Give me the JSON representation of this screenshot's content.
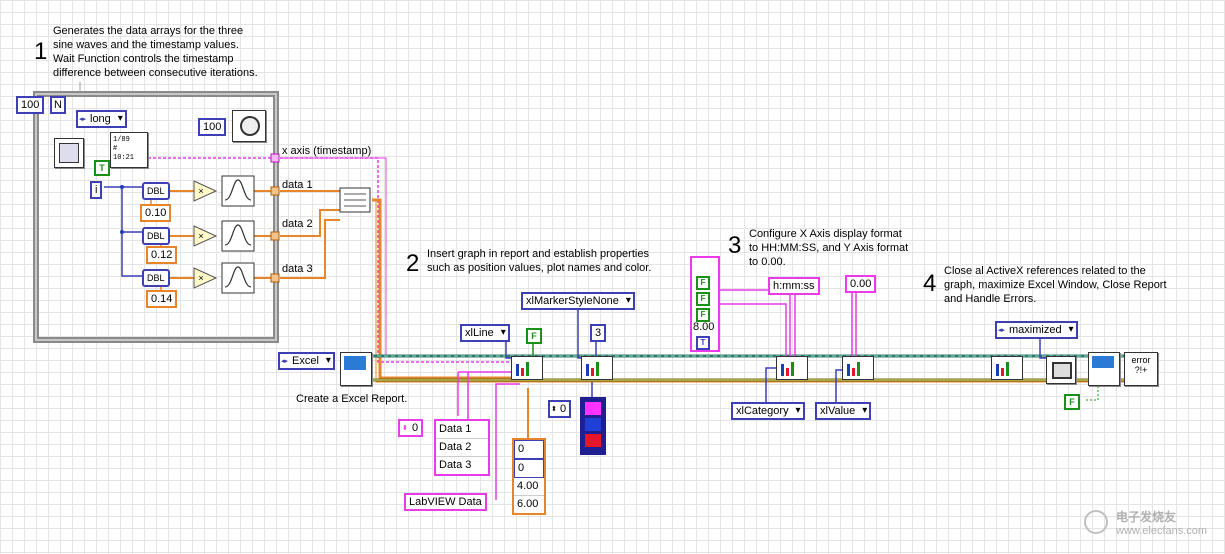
{
  "notes": {
    "step1_num": "1",
    "step1_text": "Generates the data arrays for the three\nsine waves and the timestamp values.\nWait Function controls the timestamp\ndifference between consecutive iterations.",
    "step2_num": "2",
    "step2_text": "Insert graph in report and establish properties\nsuch as position values, plot names and color.",
    "step3_num": "3",
    "step3_text": "Configure X Axis display format\nto HH:MM:SS, and Y Axis format\nto 0.00.",
    "step4_num": "4",
    "step4_text": "Close al ActiveX references related to the\ngraph, maximize Excel Window, Close Report\nand Handle Errors.",
    "create_report": "Create a Excel Report."
  },
  "loop": {
    "count": "100",
    "count_terminal": "N",
    "iteration_terminal": "i",
    "format_enum": "long",
    "wait_ms": "100",
    "true_const": "T"
  },
  "wire_labels": {
    "x_axis": "x axis (timestamp)",
    "data1": "data 1",
    "data2": "data 2",
    "data3": "data 3"
  },
  "sine_rows": [
    {
      "dbl": "DBL",
      "factor": "0.10"
    },
    {
      "dbl": "DBL",
      "factor": "0.12"
    },
    {
      "dbl": "DBL",
      "factor": "0.14"
    }
  ],
  "report": {
    "type": "Excel",
    "line_enum": "xlLine",
    "false_const": "F",
    "marker_enum": "xlMarkerStyleNone",
    "marker_num": "3",
    "plot_names_index": "0",
    "plot_names": [
      "Data 1",
      "Data 2",
      "Data 3"
    ],
    "position_values": [
      "0",
      "0",
      "4.00",
      "6.00"
    ],
    "series_name": "LabVIEW Data",
    "color_index": "0",
    "colors": [
      "#ff33ff",
      "#1f3fd6",
      "#e5162b"
    ]
  },
  "axis": {
    "bool_cluster": [
      "F",
      "F",
      "F"
    ],
    "number": "8.00",
    "true_const": "T",
    "time_format": "h:mm:ss",
    "y_format": "0.00",
    "category_enum": "xlCategory",
    "value_enum": "xlValue"
  },
  "close": {
    "window_enum": "maximized",
    "false_const": "F",
    "error_label": "error\n?!+"
  },
  "watermark": {
    "line1": "电子发烧友",
    "line2": "www.elecfans.com"
  }
}
